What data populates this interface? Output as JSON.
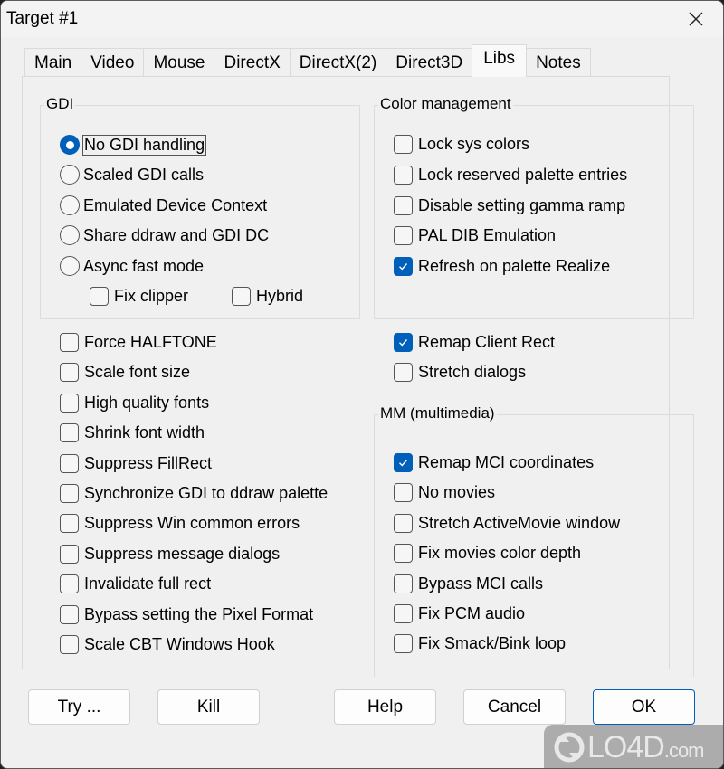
{
  "window": {
    "title": "Target #1"
  },
  "tabs": [
    {
      "label": "Main",
      "active": false
    },
    {
      "label": "Video",
      "active": false
    },
    {
      "label": "Mouse",
      "active": false
    },
    {
      "label": "DirectX",
      "active": false
    },
    {
      "label": "DirectX(2)",
      "active": false
    },
    {
      "label": "Direct3D",
      "active": false
    },
    {
      "label": "Libs",
      "active": true
    },
    {
      "label": "Notes",
      "active": false
    }
  ],
  "gdi": {
    "label": "GDI",
    "radios": [
      {
        "label": "No GDI handling",
        "checked": true
      },
      {
        "label": "Scaled GDI calls",
        "checked": false
      },
      {
        "label": "Emulated Device Context",
        "checked": false
      },
      {
        "label": "Share ddraw and GDI DC",
        "checked": false
      },
      {
        "label": "Async fast mode",
        "checked": false
      }
    ],
    "sub_checks": [
      {
        "label": "Fix clipper",
        "checked": false
      },
      {
        "label": "Hybrid",
        "checked": false
      }
    ]
  },
  "left_checks": [
    {
      "label": "Force HALFTONE",
      "checked": false
    },
    {
      "label": "Scale font size",
      "checked": false
    },
    {
      "label": "High quality fonts",
      "checked": false
    },
    {
      "label": "Shrink font width",
      "checked": false
    },
    {
      "label": "Suppress FillRect",
      "checked": false
    },
    {
      "label": "Synchronize GDI to ddraw palette",
      "checked": false
    },
    {
      "label": "Suppress Win common errors",
      "checked": false
    },
    {
      "label": "Suppress message dialogs",
      "checked": false
    },
    {
      "label": "Invalidate full rect",
      "checked": false
    },
    {
      "label": "Bypass setting the Pixel Format",
      "checked": false
    },
    {
      "label": "Scale CBT Windows Hook",
      "checked": false
    }
  ],
  "color_management": {
    "label": "Color management",
    "checks": [
      {
        "label": "Lock sys colors",
        "checked": false
      },
      {
        "label": "Lock reserved palette entries",
        "checked": false
      },
      {
        "label": "Disable setting gamma ramp",
        "checked": false
      },
      {
        "label": "PAL DIB Emulation",
        "checked": false
      },
      {
        "label": "Refresh on palette Realize",
        "checked": true
      }
    ]
  },
  "right_checks": [
    {
      "label": "Remap Client Rect",
      "checked": true
    },
    {
      "label": "Stretch dialogs",
      "checked": false
    }
  ],
  "multimedia": {
    "label": "MM (multimedia)",
    "checks": [
      {
        "label": "Remap MCI coordinates",
        "checked": true
      },
      {
        "label": "No movies",
        "checked": false
      },
      {
        "label": "Stretch ActiveMovie window",
        "checked": false
      },
      {
        "label": "Fix movies color depth",
        "checked": false
      },
      {
        "label": "Bypass MCI calls",
        "checked": false
      },
      {
        "label": "Fix PCM audio",
        "checked": false
      },
      {
        "label": "Fix Smack/Bink loop",
        "checked": false
      }
    ]
  },
  "buttons": {
    "try": "Try ...",
    "kill": "Kill",
    "help": "Help",
    "cancel": "Cancel",
    "ok": "OK"
  },
  "watermark": {
    "brand": "LO4D",
    "suffix": ".com"
  },
  "colors": {
    "accent": "#005fb8",
    "background": "#f0f0f0"
  }
}
